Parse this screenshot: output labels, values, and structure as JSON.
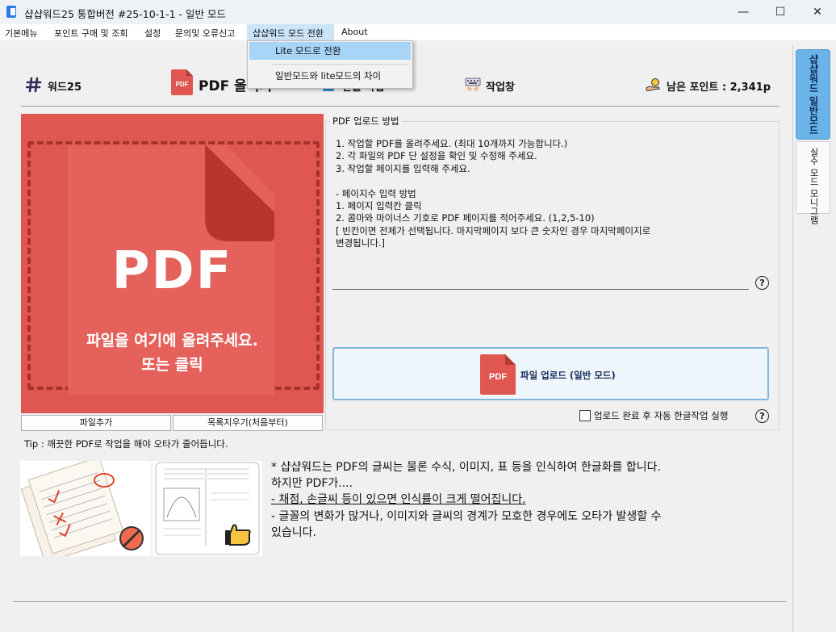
{
  "window": {
    "title": "샵샵워드25 통합버전 #25-10-1-1 - 일반 모드",
    "minimize": "—",
    "maximize": "☐",
    "close": "✕"
  },
  "menu": {
    "items": [
      "기본메뉴",
      "포인트 구매 및 조회",
      "설정",
      "문의및 오류신고",
      "샵샵워드 모드 전환",
      "About"
    ]
  },
  "dropdown": {
    "items": [
      "Lite 모드로 전환",
      "일반모드와 lite모드의 차이"
    ]
  },
  "toolbar": {
    "words25": "워드25",
    "pdf_upload": "PDF 올리기",
    "hangul_work": "한글 작업",
    "workspace": "작업창",
    "points_label": "남은 포인트 : 2,341p"
  },
  "dropzone": {
    "pdf_text": "PDF",
    "line1": "파일을 여기에 올려주세요.",
    "line2": "또는 클릭",
    "add_file": "파일추가",
    "clear_list": "목록지우기(처음부터)"
  },
  "instructions": {
    "title": "PDF 업로드 방법",
    "text": "1. 작업할 PDF를 올려주세요. (최대 10개까지 가능합니다.)\n2. 각 파일의 PDF 단 설정을 확인 및 수정해 주세요.\n3. 작업할 페이지를 입력해 주세요.\n\n- 페이지수 입력 방법\n1. 페이지 입력칸 클릭\n2. 콤마와 마이너스 기호로 PDF 페이지를 적어주세요. (1,2,5-10)\n[ 빈칸이면 전체가 선택됩니다. 마지막페이지 보다 큰 숫자인 경우 마지막페이지로\n변경됩니다.]"
  },
  "upload": {
    "icon_text": "PDF",
    "label": "파일 업로드 (일반 모드)",
    "auto_label": "업로드 완료 후 자동 한글작업 실행"
  },
  "help_icon": "?",
  "tip": "Tip : 깨끗한 PDF로 작업을 해야 오타가 줄어듭니다.",
  "description": {
    "line1": "* 샵샵워드는 PDF의 글씨는 물론 수식, 이미지, 표 등을 인식하여 한글화를 합니다.",
    "line2": "하지만 PDF가....",
    "line3": "- 채점, 손글씨 등이 있으면 인식률이 크게 떨어집니다.",
    "line4": "- 글꼴의 변화가 많거나, 이미지와 글씨의 경계가 모호한 경우에도 오타가 발생할 수",
    "line5": "있습니다."
  },
  "side_tabs": {
    "normal": "샵샵워드 일반모드",
    "mistake": "실수 모드 모니그램"
  },
  "colors": {
    "pdf_red": "#e05650",
    "accent_blue": "#6ab4e8",
    "dropdown_highlight": "#a8d4f7"
  }
}
